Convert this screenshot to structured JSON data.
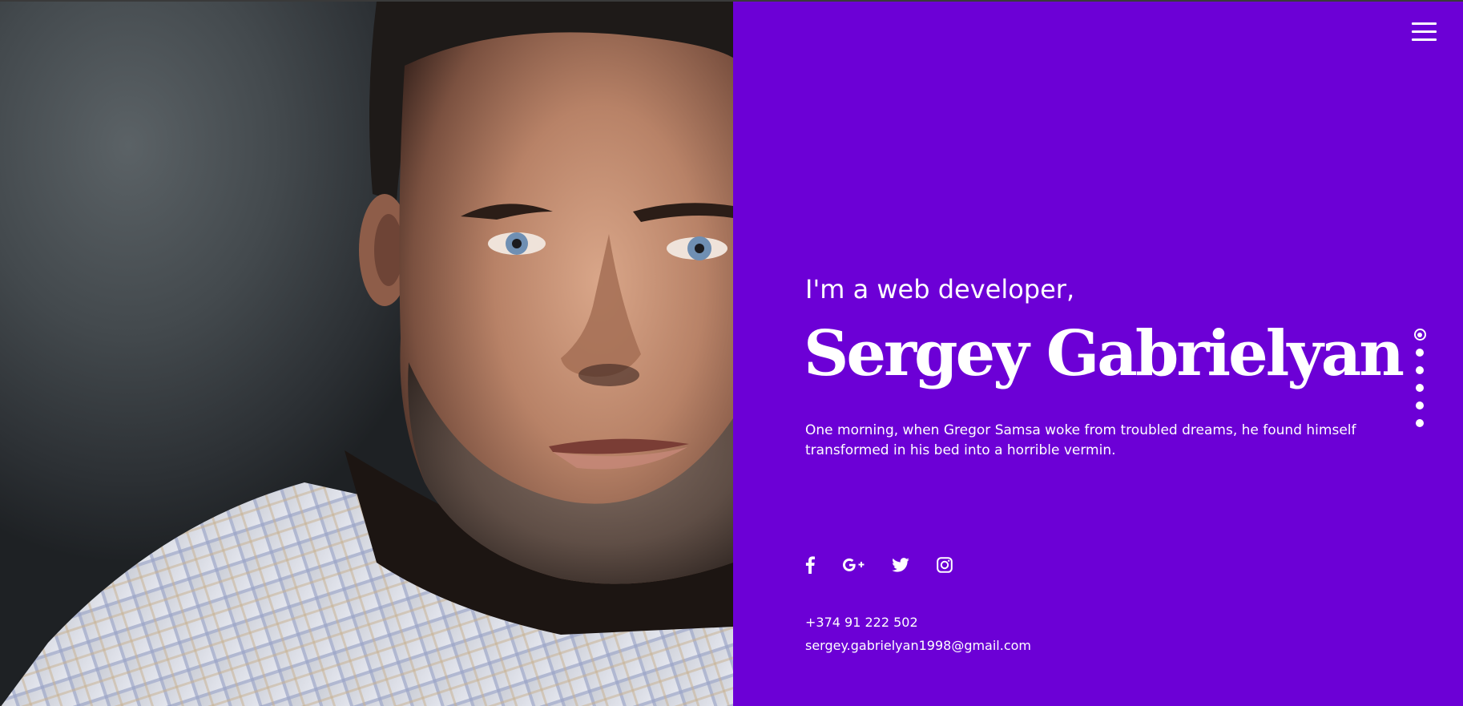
{
  "photo": {
    "alt": "portrait"
  },
  "header": {
    "menu_icon": "hamburger-menu-icon"
  },
  "hero": {
    "intro": "I'm a web developer,",
    "name": "Sergey Gabrielyan",
    "bio": "One morning, when Gregor Samsa woke from troubled dreams, he found himself transformed in his bed into a horrible vermin."
  },
  "socials": [
    {
      "icon": "facebook-icon"
    },
    {
      "icon": "google-plus-icon"
    },
    {
      "icon": "twitter-icon"
    },
    {
      "icon": "instagram-icon"
    }
  ],
  "contact": {
    "phone": "+374 91 222 502",
    "email": "sergey.gabrielyan1998@gmail.com"
  },
  "pagination": {
    "count": 6,
    "active_index": 0
  },
  "colors": {
    "accent": "#6c00d6",
    "text": "#ffffff",
    "photo_background": "#43494d"
  }
}
